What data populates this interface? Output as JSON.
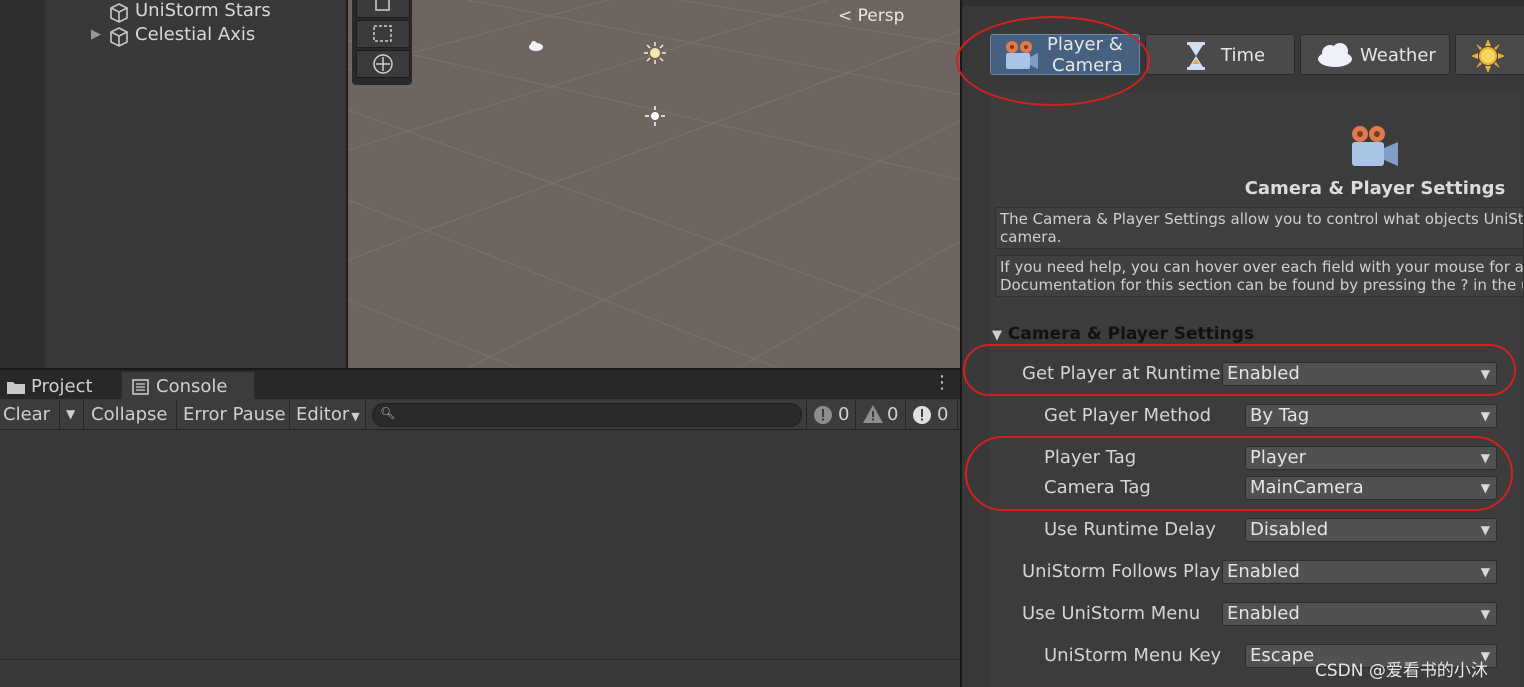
{
  "hierarchy": {
    "items": [
      {
        "label": "UniStorm Stars",
        "expandable": false
      },
      {
        "label": "Celestial Axis",
        "expandable": true
      }
    ]
  },
  "scene": {
    "persp_label": "Persp"
  },
  "console": {
    "tabs": [
      {
        "label": "Project"
      },
      {
        "label": "Console"
      }
    ],
    "toolbar": {
      "clear": "Clear",
      "collapse": "Collapse",
      "error_pause": "Error Pause",
      "editor": "Editor",
      "search_placeholder": "",
      "log_count": "0",
      "warning_count": "0",
      "error_count": "0"
    }
  },
  "inspector": {
    "tabs": [
      {
        "label_line1": "Player &",
        "label_line2": "Camera",
        "icon": "camera-icon",
        "active": true
      },
      {
        "label": "Time",
        "icon": "hourglass-icon"
      },
      {
        "label": "Weather",
        "icon": "cloud-icon"
      },
      {
        "label": "",
        "icon": "sun-icon"
      }
    ],
    "section_title": "Camera & Player Settings",
    "help_1_line1": "The Camera & Player Settings allow you to control what objects UniStor",
    "help_1_line2": "camera.",
    "help_2_line1": "If you need help, you can hover over each field with your mouse for a",
    "help_2_line2": "Documentation for this section can be found by pressing the ? in the u",
    "foldout_label": "Camera & Player Settings",
    "fields": [
      {
        "label": "Get Player at Runtime",
        "value": "Enabled"
      },
      {
        "label": "Get Player Method",
        "value": "By Tag"
      },
      {
        "label": "Player Tag",
        "value": "Player"
      },
      {
        "label": "Camera Tag",
        "value": "MainCamera"
      },
      {
        "label": "Use Runtime Delay",
        "value": "Disabled"
      },
      {
        "label": "UniStorm Follows Play",
        "value": "Enabled"
      },
      {
        "label": "Use UniStorm Menu",
        "value": "Enabled"
      },
      {
        "label": "UniStorm Menu Key",
        "value": "Escape"
      }
    ],
    "watermark": "CSDN @爱看书的小沐"
  },
  "colors": {
    "annotation_red": "#d42020",
    "active_tab_blue": "#46607f"
  }
}
